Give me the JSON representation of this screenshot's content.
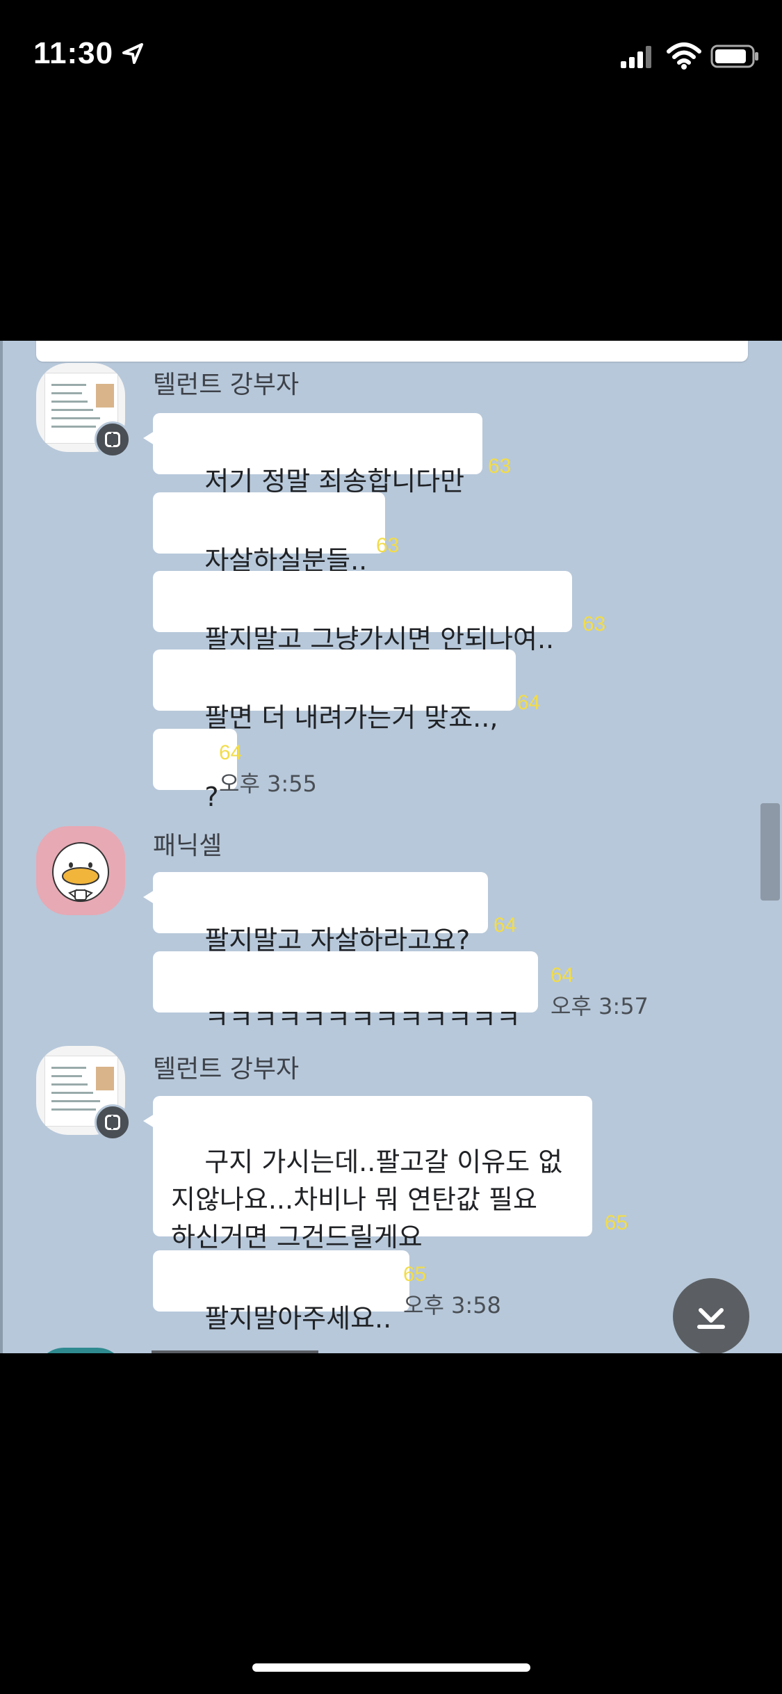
{
  "status_bar": {
    "time": "11:30"
  },
  "chat": {
    "groups": [
      {
        "sender": "텔런트 강부자",
        "messages": [
          {
            "text": "저기 정말 죄송합니다만",
            "unread": "63"
          },
          {
            "text": "자살하실분들..",
            "unread": "63"
          },
          {
            "text": "팔지말고 그냥가시면 안되나여..",
            "unread": "63"
          },
          {
            "text": "팔면 더 내려가는거 맞죠..,",
            "unread": "64"
          },
          {
            "text": "?",
            "unread": "64",
            "time": "오후 3:55"
          }
        ]
      },
      {
        "sender": "패닉셀",
        "messages": [
          {
            "text": "팔지말고 자살하라고요?",
            "unread": "64"
          },
          {
            "text": "ㅋㅋㅋㅋㅋㅋㅋㅋㅋㅋㅋㅋㅋ",
            "unread": "64",
            "time": "오후 3:57"
          }
        ]
      },
      {
        "sender": "텔런트 강부자",
        "messages": [
          {
            "text": "구지 가시는데..팔고갈 이유도 없\n지않나요...차비나 뭐 연탄값 필요\n하신거면 그건드릴게요",
            "unread": "65"
          },
          {
            "text": "팔지말아주세요..",
            "unread": "65",
            "time": "오후 3:58"
          }
        ]
      }
    ]
  },
  "icons": {
    "location": "location-arrow-icon",
    "signal": "cellular-signal-icon",
    "wifi": "wifi-icon",
    "battery": "battery-icon",
    "scroll_down": "scroll-to-bottom-icon"
  },
  "colors": {
    "chat_background": "#b7c8da",
    "unread_count": "#f2dc4a",
    "bubble": "#ffffff"
  }
}
